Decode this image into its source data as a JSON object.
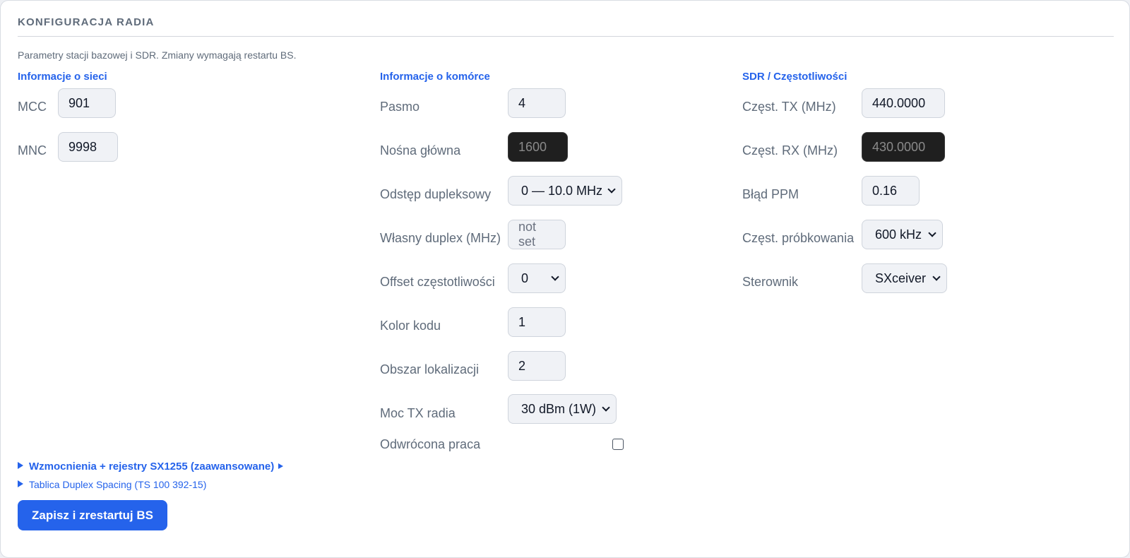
{
  "header": {
    "title": "KONFIGURACJA RADIA",
    "description": "Parametry stacji bazowej i SDR. Zmiany wymagają restartu BS."
  },
  "network": {
    "heading": "Informacje o sieci",
    "mcc_label": "MCC",
    "mcc_value": "901",
    "mnc_label": "MNC",
    "mnc_value": "9998"
  },
  "cell": {
    "heading": "Informacje o komórce",
    "band_label": "Pasmo",
    "band_value": "4",
    "main_carrier_label": "Nośna główna",
    "main_carrier_value": "1600",
    "duplex_spacing_label": "Odstęp dupleksowy",
    "duplex_spacing_value": "0 — 10.0 MHz",
    "custom_duplex_label": "Własny duplex (MHz)",
    "custom_duplex_placeholder": "not set",
    "freq_offset_label": "Offset częstotliwości",
    "freq_offset_value": "0",
    "color_code_label": "Kolor kodu",
    "color_code_value": "1",
    "location_area_label": "Obszar lokalizacji",
    "location_area_value": "2",
    "tx_power_label": "Moc TX radia",
    "tx_power_value": "30 dBm (1W)",
    "reverse_label": "Odwrócona praca"
  },
  "sdr": {
    "heading": "SDR / Częstotliwości",
    "tx_freq_label": "Częst. TX (MHz)",
    "tx_freq_value": "440.0000",
    "rx_freq_label": "Częst. RX (MHz)",
    "rx_freq_value": "430.0000",
    "ppm_label": "Błąd PPM",
    "ppm_value": "0.16",
    "sample_rate_label": "Częst. próbkowania",
    "sample_rate_value": "600 kHz",
    "driver_label": "Sterownik",
    "driver_value": "SXceiver"
  },
  "advanced": {
    "gains_label": "Wzmocnienia + rejestry SX1255 (zaawansowane)",
    "duplex_table_label": "Tablica Duplex Spacing (TS 100 392-15)"
  },
  "actions": {
    "save_label": "Zapisz i zrestartuj BS"
  }
}
